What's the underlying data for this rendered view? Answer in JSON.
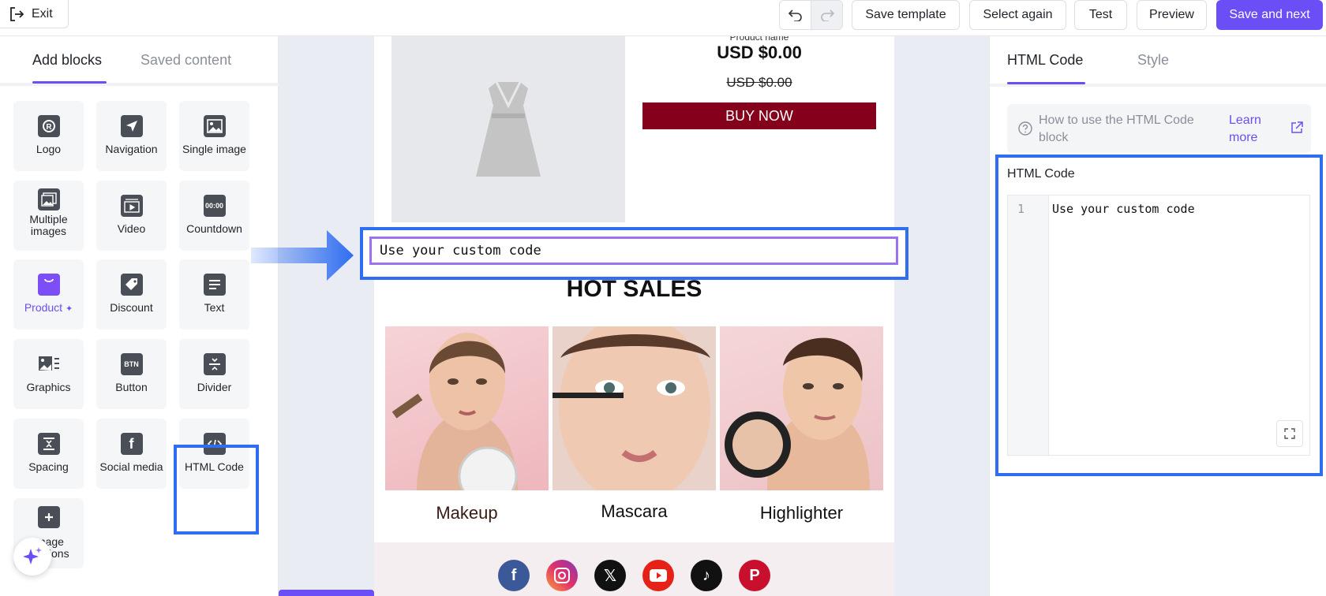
{
  "topbar": {
    "exit_label": "Exit",
    "save_template_label": "Save template",
    "select_again_label": "Select again",
    "test_label": "Test",
    "preview_label": "Preview",
    "save_next_label": "Save and next",
    "accent_color": "#6b4ef6"
  },
  "left_panel": {
    "tabs": [
      "Add blocks",
      "Saved content"
    ],
    "blocks": [
      {
        "label": "Logo",
        "icon": "logo-icon"
      },
      {
        "label": "Navigation",
        "icon": "navigation-icon"
      },
      {
        "label": "Single image",
        "icon": "image-icon"
      },
      {
        "label": "Multiple images",
        "icon": "images-icon"
      },
      {
        "label": "Video",
        "icon": "video-icon"
      },
      {
        "label": "Countdown",
        "icon": "countdown-icon"
      },
      {
        "label": "Product",
        "icon": "product-icon"
      },
      {
        "label": "Discount",
        "icon": "discount-icon"
      },
      {
        "label": "Text",
        "icon": "text-icon"
      },
      {
        "label": "Graphics",
        "icon": "graphics-icon"
      },
      {
        "label": "Button",
        "icon": "button-icon"
      },
      {
        "label": "Divider",
        "icon": "divider-icon"
      },
      {
        "label": "Spacing",
        "icon": "spacing-icon"
      },
      {
        "label": "Social media",
        "icon": "social-media-icon"
      },
      {
        "label": "HTML Code",
        "icon": "html-code-icon"
      },
      {
        "label": "Image captions",
        "icon": "image-captions-icon"
      }
    ],
    "button_icon_text": "BTN",
    "countdown_icon_text": "00:00"
  },
  "email": {
    "product_name": "Product name",
    "price": "USD $0.00",
    "old_price": "USD $0.00",
    "buy_label": "BUY NOW",
    "buy_color": "#85001b",
    "custom_code_text": "Use your custom code",
    "section_title": "HOT SALES",
    "products": [
      {
        "caption": "Makeup"
      },
      {
        "caption": "Mascara"
      },
      {
        "caption": "Highlighter"
      }
    ],
    "social_icons": [
      "facebook-icon",
      "instagram-icon",
      "x-icon",
      "youtube-icon",
      "tiktok-icon",
      "pinterest-icon"
    ]
  },
  "right_panel": {
    "tabs": [
      "HTML Code",
      "Style"
    ],
    "help_text": "How to use the HTML Code block",
    "help_link": "Learn more",
    "panel_title": "HTML Code",
    "line_number": "1",
    "code_text": "Use your custom code"
  },
  "highlight_color": "#2f6df2"
}
